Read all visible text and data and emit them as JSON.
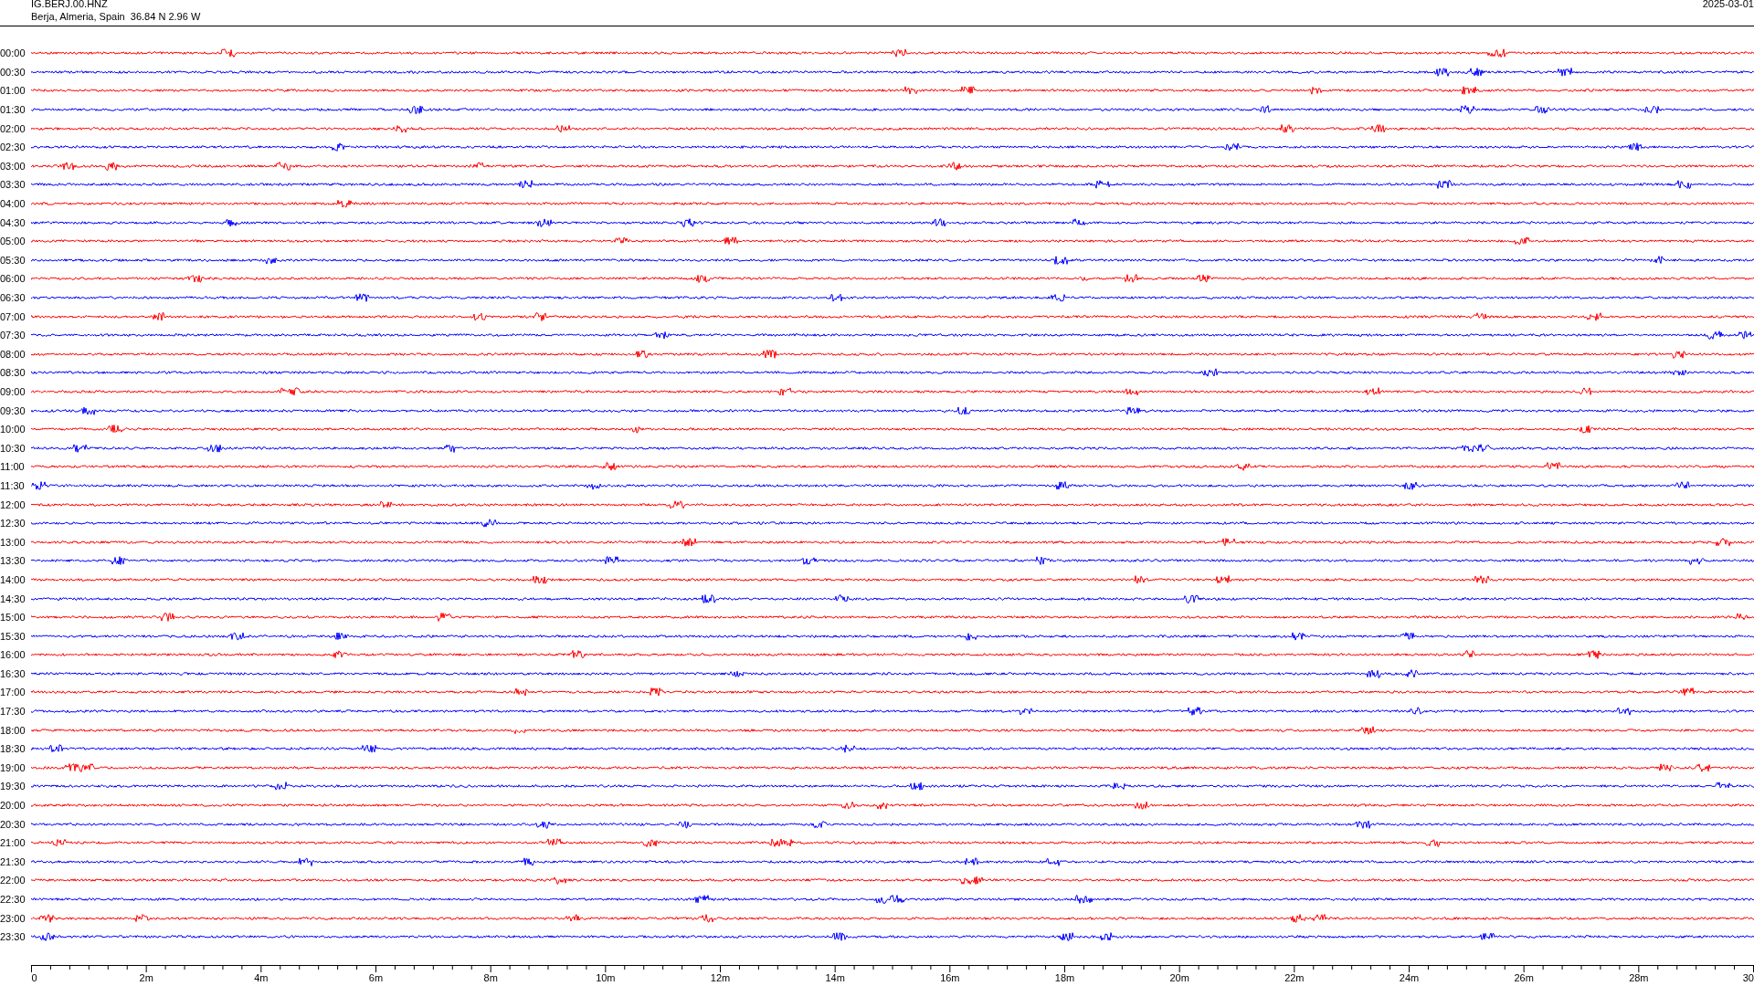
{
  "header": {
    "station": "IG.BERJ.00.HNZ",
    "location": "Berja, Almeria, Spain  36.84 N 2.96 W",
    "date": "2025-03-01"
  },
  "traces": [
    {
      "time": "00:00",
      "color": "#ff0000"
    },
    {
      "time": "00:30",
      "color": "#0000ff"
    },
    {
      "time": "01:00",
      "color": "#ff0000"
    },
    {
      "time": "01:30",
      "color": "#0000ff"
    },
    {
      "time": "02:00",
      "color": "#ff0000"
    },
    {
      "time": "02:30",
      "color": "#0000ff"
    },
    {
      "time": "03:00",
      "color": "#ff0000"
    },
    {
      "time": "03:30",
      "color": "#0000ff"
    },
    {
      "time": "04:00",
      "color": "#ff0000"
    },
    {
      "time": "04:30",
      "color": "#0000ff"
    },
    {
      "time": "05:00",
      "color": "#ff0000"
    },
    {
      "time": "05:30",
      "color": "#0000ff"
    },
    {
      "time": "06:00",
      "color": "#ff0000"
    },
    {
      "time": "06:30",
      "color": "#0000ff"
    },
    {
      "time": "07:00",
      "color": "#ff0000"
    },
    {
      "time": "07:30",
      "color": "#0000ff"
    },
    {
      "time": "08:00",
      "color": "#ff0000"
    },
    {
      "time": "08:30",
      "color": "#0000ff"
    },
    {
      "time": "09:00",
      "color": "#ff0000"
    },
    {
      "time": "09:30",
      "color": "#0000ff"
    },
    {
      "time": "10:00",
      "color": "#ff0000"
    },
    {
      "time": "10:30",
      "color": "#0000ff"
    },
    {
      "time": "11:00",
      "color": "#ff0000"
    },
    {
      "time": "11:30",
      "color": "#0000ff"
    },
    {
      "time": "12:00",
      "color": "#ff0000"
    },
    {
      "time": "12:30",
      "color": "#0000ff"
    },
    {
      "time": "13:00",
      "color": "#ff0000"
    },
    {
      "time": "13:30",
      "color": "#0000ff"
    },
    {
      "time": "14:00",
      "color": "#ff0000"
    },
    {
      "time": "14:30",
      "color": "#0000ff"
    },
    {
      "time": "15:00",
      "color": "#ff0000"
    },
    {
      "time": "15:30",
      "color": "#0000ff"
    },
    {
      "time": "16:00",
      "color": "#ff0000"
    },
    {
      "time": "16:30",
      "color": "#0000ff"
    },
    {
      "time": "17:00",
      "color": "#ff0000"
    },
    {
      "time": "17:30",
      "color": "#0000ff"
    },
    {
      "time": "18:00",
      "color": "#ff0000"
    },
    {
      "time": "18:30",
      "color": "#0000ff"
    },
    {
      "time": "19:00",
      "color": "#ff0000"
    },
    {
      "time": "19:30",
      "color": "#0000ff"
    },
    {
      "time": "20:00",
      "color": "#ff0000"
    },
    {
      "time": "20:30",
      "color": "#0000ff"
    },
    {
      "time": "21:00",
      "color": "#ff0000"
    },
    {
      "time": "21:30",
      "color": "#0000ff"
    },
    {
      "time": "22:00",
      "color": "#ff0000"
    },
    {
      "time": "22:30",
      "color": "#0000ff"
    },
    {
      "time": "23:00",
      "color": "#ff0000"
    },
    {
      "time": "23:30",
      "color": "#0000ff"
    }
  ],
  "time_axis": {
    "ticks": [
      "0",
      "2m",
      "4m",
      "6m",
      "8m",
      "10m",
      "12m",
      "14m",
      "16m",
      "18m",
      "20m",
      "22m",
      "24m",
      "26m",
      "28m",
      "30"
    ]
  }
}
